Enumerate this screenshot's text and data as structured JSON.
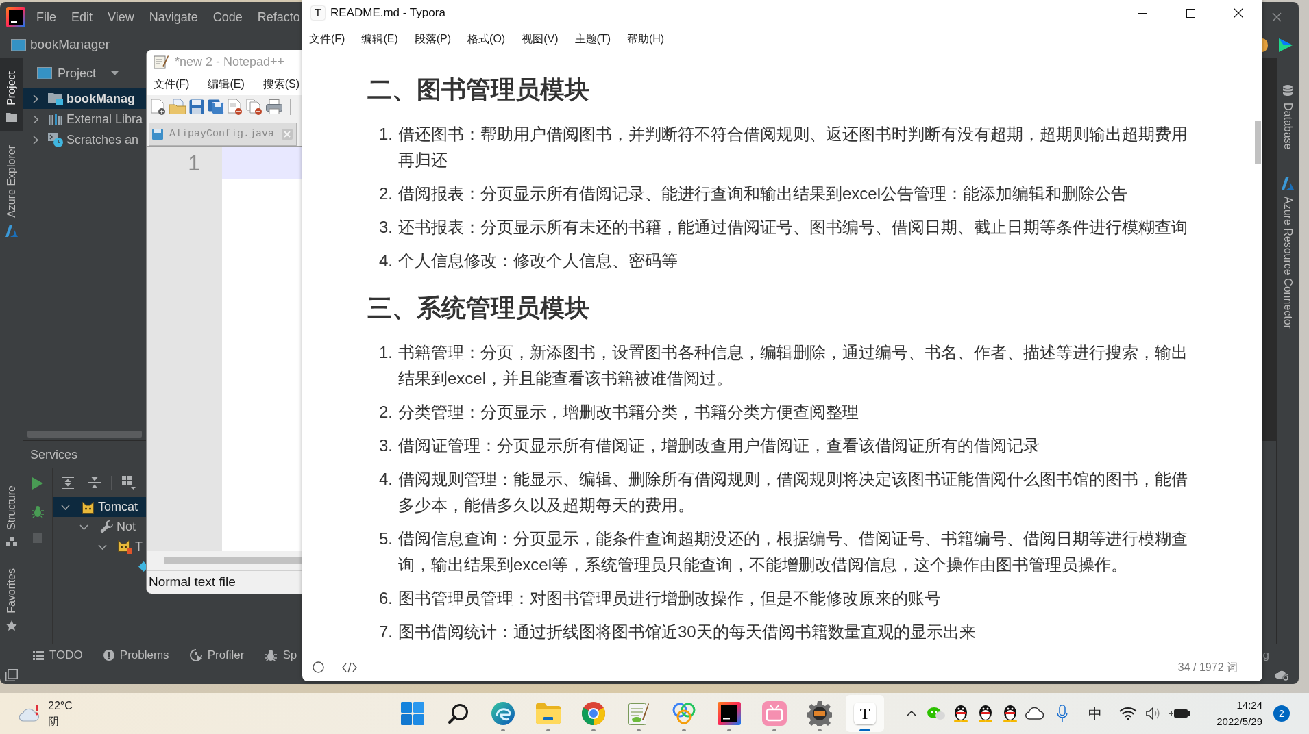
{
  "ide": {
    "menu": [
      "File",
      "Edit",
      "View",
      "Navigate",
      "Code",
      "Refacto"
    ],
    "breadcrumb": "bookManager",
    "left_tool_tabs": [
      {
        "label": "Project",
        "kind": "folder",
        "selected": true
      },
      {
        "label": "Azure Explorer",
        "kind": "azure",
        "selected": false
      }
    ],
    "left_tool_tabs_lower": [
      {
        "label": "Structure",
        "kind": "structure"
      },
      {
        "label": "Favorites",
        "kind": "star"
      }
    ],
    "project_panel": {
      "title": "Project",
      "tree": [
        {
          "label": "bookManag",
          "kind": "module",
          "selected": true,
          "expanded": false
        },
        {
          "label": "External Libra",
          "kind": "libraries",
          "selected": false,
          "expanded": false
        },
        {
          "label": "Scratches an",
          "kind": "scratches",
          "selected": false,
          "expanded": false
        }
      ]
    },
    "services": {
      "title": "Services",
      "tree": [
        {
          "label": "Tomcat",
          "kind": "server",
          "selected": true,
          "expanded": true,
          "children": [
            {
              "label": "Not",
              "kind": "group",
              "selected": false,
              "expanded": true,
              "children": [
                {
                  "label": "T",
                  "kind": "config",
                  "selected": false,
                  "expanded": true,
                  "children": [
                    {
                      "kind": "artifact",
                      "selected": false
                    }
                  ]
                }
              ]
            }
          ]
        }
      ]
    },
    "bottom_tool_tabs": [
      {
        "label": "TODO",
        "kind": "list"
      },
      {
        "label": "Problems",
        "kind": "alert"
      },
      {
        "label": "Profiler",
        "kind": "profiler"
      },
      {
        "label": "Sp",
        "kind": "bug"
      }
    ],
    "bottom_tool_tab_right": "g",
    "right_tool_tabs": [
      {
        "label": "Database",
        "kind": "database"
      },
      {
        "label": "Azure Resource Connector",
        "kind": "azure"
      }
    ]
  },
  "notepad": {
    "title": "*new 2 - Notepad++",
    "menu": [
      "文件(F)",
      "编辑(E)",
      "搜索(S)"
    ],
    "tabs": [
      {
        "label": "AlipayConfig.java",
        "selected": false
      }
    ],
    "line_numbers": [
      "1"
    ],
    "status": "Normal text file"
  },
  "typora": {
    "icon_glyph": "T",
    "title": "README.md - Typora",
    "menu": [
      "文件(F)",
      "编辑(E)",
      "段落(P)",
      "格式(O)",
      "视图(V)",
      "主题(T)",
      "帮助(H)"
    ],
    "sections": [
      {
        "heading": "二、图书管理员模块",
        "items": [
          {
            "number": "1.",
            "text": "借还图书：帮助用户借阅图书，并判断符不符合借阅规则、返还图书时判断有没有超期，超期则输出超期费用再归还"
          },
          {
            "number": "2.",
            "text": "借阅报表：分页显示所有借阅记录、能进行查询和输出结果到excel公告管理：能添加编辑和删除公告"
          },
          {
            "number": "3.",
            "text": "还书报表：分页显示所有未还的书籍，能通过借阅证号、图书编号、借阅日期、截止日期等条件进行模糊查询"
          },
          {
            "number": "4.",
            "text": "个人信息修改：修改个人信息、密码等"
          }
        ]
      },
      {
        "heading": "三、系统管理员模块",
        "items": [
          {
            "number": "1.",
            "text": "书籍管理：分页，新添图书，设置图书各种信息，编辑删除，通过编号、书名、作者、描述等进行搜索，输出结果到excel，并且能查看该书籍被谁借阅过。"
          },
          {
            "number": "2.",
            "text": "分类管理：分页显示，增删改书籍分类，书籍分类方便查阅整理"
          },
          {
            "number": "3.",
            "text": "借阅证管理：分页显示所有借阅证，增删改查用户借阅证，查看该借阅证所有的借阅记录"
          },
          {
            "number": "4.",
            "text": "借阅规则管理：能显示、编辑、删除所有借阅规则，借阅规则将决定该图书证能借阅什么图书馆的图书，能借多少本，能借多久以及超期每天的费用。"
          },
          {
            "number": "5.",
            "text": "借阅信息查询：分页显示，能条件查询超期没还的，根据编号、借阅证号、书籍编号、借阅日期等进行模糊查询，输出结果到excel等，系统管理员只能查询，不能增删改借阅信息，这个操作由图书管理员操作。"
          },
          {
            "number": "6.",
            "text": "图书管理员管理：对图书管理员进行增删改操作，但是不能修改原来的账号"
          },
          {
            "number": "7.",
            "text": "图书借阅统计：通过折线图将图书馆近30天的每天借阅书籍数量直观的显示出来"
          }
        ]
      }
    ],
    "word_count": "34 / 1972 词"
  },
  "taskbar": {
    "weather": {
      "temperature": "22°C",
      "condition": "阴"
    },
    "apps": [
      {
        "kind": "start",
        "running": false,
        "selected": false
      },
      {
        "kind": "search",
        "running": false,
        "selected": false
      },
      {
        "kind": "edge",
        "running": true,
        "selected": false
      },
      {
        "kind": "files",
        "running": true,
        "selected": false
      },
      {
        "kind": "chrome",
        "running": true,
        "selected": false
      },
      {
        "kind": "notepad",
        "running": true,
        "selected": false
      },
      {
        "kind": "rings",
        "running": true,
        "selected": false
      },
      {
        "kind": "intellij",
        "running": true,
        "selected": false
      },
      {
        "kind": "bilibili",
        "running": true,
        "selected": false
      },
      {
        "kind": "javafp",
        "running": true,
        "selected": false
      },
      {
        "kind": "typora",
        "glyph": "T",
        "running": true,
        "selected": true
      }
    ],
    "tray": [
      {
        "kind": "chevron"
      },
      {
        "kind": "chat"
      },
      {
        "kind": "penguin"
      },
      {
        "kind": "penguin"
      },
      {
        "kind": "penguin"
      },
      {
        "kind": "cloud"
      },
      {
        "kind": "mic"
      },
      {
        "kind": "ime",
        "glyph": "中"
      },
      {
        "kind": "wifi"
      },
      {
        "kind": "volume"
      },
      {
        "kind": "battery"
      }
    ],
    "clock": {
      "time": "14:24",
      "date": "2022/5/29"
    },
    "notification_count": "2"
  }
}
